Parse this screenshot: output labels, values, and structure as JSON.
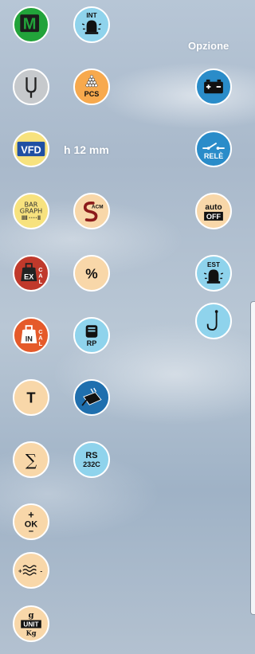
{
  "header": {
    "option_label": "Opzione"
  },
  "colors": {
    "green": "#22a33a",
    "light_blue": "#8fd3ec",
    "peach": "#f8d7a9",
    "yellow": "#f7e27e",
    "red": "#c0392b",
    "orange": "#e55a2a",
    "blue": "#1f6fae",
    "dark_blue": "#2a5ea3",
    "grey": "#c6c9cc"
  },
  "left_icons": [
    {
      "name": "m-icon",
      "text": "M"
    },
    {
      "name": "tuning-fork-icon"
    },
    {
      "name": "vfd-display-icon",
      "text": "VFD"
    },
    {
      "name": "bar-graph-icon",
      "text_top": "BAR",
      "text_bottom": "GRAPH"
    },
    {
      "name": "ex-cal-weight-icon",
      "text_main": "EX",
      "text_side": "CAL"
    },
    {
      "name": "in-cal-weight-icon",
      "text_main": "IN",
      "text_side": "CAL"
    },
    {
      "name": "tare-icon",
      "text": "T"
    },
    {
      "name": "sum-icon",
      "text": "∑"
    },
    {
      "name": "ok-plus-minus-icon",
      "text_plus": "+",
      "text": "OK",
      "text_minus": "−"
    },
    {
      "name": "filter-icon",
      "text_plus": "+",
      "text_minus": "-"
    },
    {
      "name": "unit-icon",
      "text_top": "g",
      "text": "UNIT",
      "text_bottom": "Kg"
    }
  ],
  "middle_icons": [
    {
      "name": "int-bell-icon",
      "text": "INT"
    },
    {
      "name": "pcs-counting-icon",
      "text": "PCS"
    },
    {
      "name": "acm-icon",
      "text": "ACM"
    },
    {
      "name": "percent-icon",
      "text": "%"
    },
    {
      "name": "printer-rp-icon",
      "text": "RP"
    },
    {
      "name": "power-adapter-icon"
    },
    {
      "name": "rs232c-icon",
      "text_top": "RS",
      "text_bottom": "232C"
    }
  ],
  "vfd_height_label": "h 12 mm",
  "right_icons": [
    {
      "name": "battery-icon"
    },
    {
      "name": "rele-icon",
      "text": "RELÈ"
    },
    {
      "name": "auto-off-icon",
      "text_top": "auto",
      "text_bottom": "OFF"
    },
    {
      "name": "est-bell-icon",
      "text": "EST"
    },
    {
      "name": "hook-icon"
    }
  ]
}
